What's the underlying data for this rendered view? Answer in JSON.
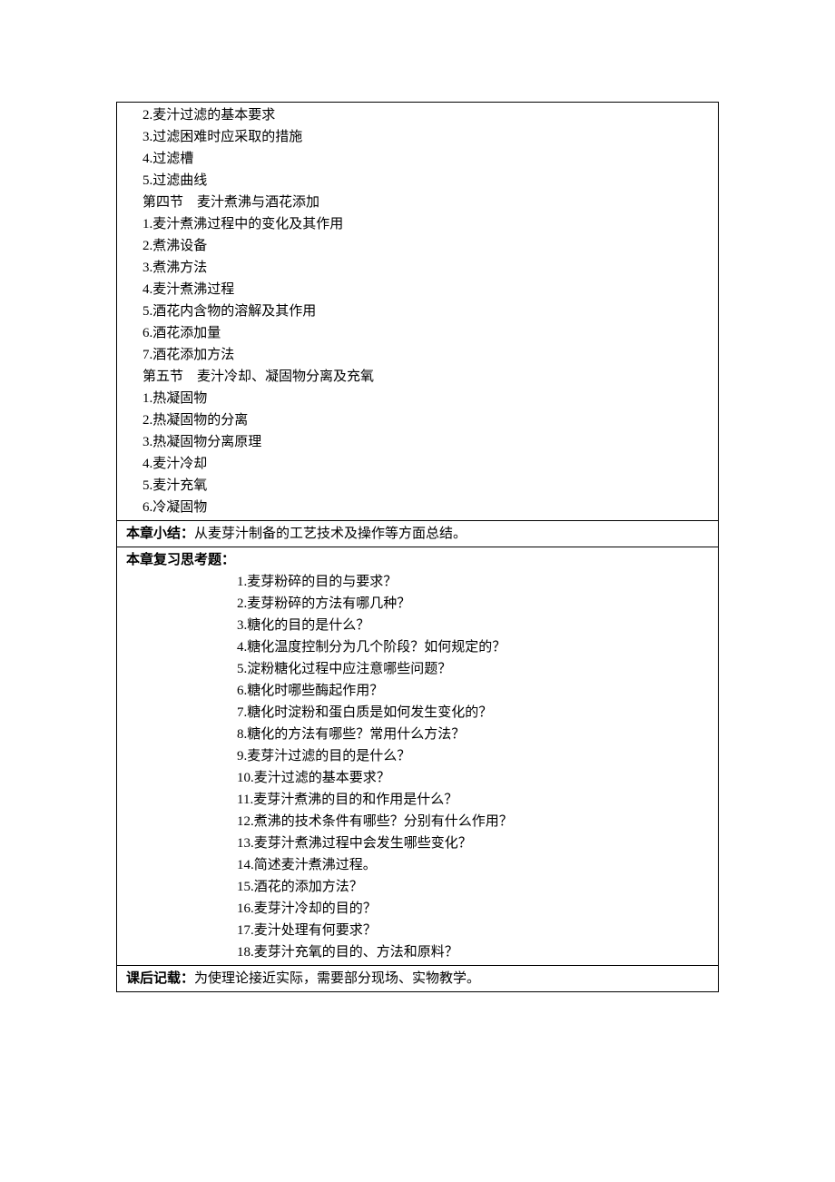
{
  "content": {
    "lines": [
      "2.麦汁过滤的基本要求",
      "3.过滤困难时应采取的措施",
      "4.过滤槽",
      "5.过滤曲线",
      "第四节　麦汁煮沸与酒花添加",
      "1.麦汁煮沸过程中的变化及其作用",
      "2.煮沸设备",
      "3.煮沸方法",
      "4.麦汁煮沸过程",
      "5.酒花内含物的溶解及其作用",
      "6.酒花添加量",
      "7.酒花添加方法",
      "第五节　麦汁冷却、凝固物分离及充氧",
      "1.热凝固物",
      "2.热凝固物的分离",
      "3.热凝固物分离原理",
      "4.麦汁冷却",
      "5.麦汁充氧",
      "6.冷凝固物"
    ]
  },
  "summary": {
    "label": "本章小结：",
    "text": "从麦芽汁制备的工艺技术及操作等方面总结。"
  },
  "review": {
    "label": "本章复习思考题：",
    "items": [
      "1.麦芽粉碎的目的与要求？",
      "2.麦芽粉碎的方法有哪几种？",
      "3.糖化的目的是什么？",
      "4.糖化温度控制分为几个阶段？如何规定的？",
      "5.淀粉糖化过程中应注意哪些问题？",
      "6.糖化时哪些酶起作用？",
      "7.糖化时淀粉和蛋白质是如何发生变化的？",
      "8.糖化的方法有哪些？常用什么方法？",
      "9.麦芽汁过滤的目的是什么？",
      "10.麦汁过滤的基本要求？",
      "11.麦芽汁煮沸的目的和作用是什么？",
      "12.煮沸的技术条件有哪些？分别有什么作用？",
      "13.麦芽汁煮沸过程中会发生哪些变化？",
      "14.简述麦汁煮沸过程。",
      "15.酒花的添加方法？",
      "16.麦芽汁冷却的目的？",
      "17.麦汁处理有何要求？",
      "18.麦芽汁充氧的目的、方法和原料？"
    ]
  },
  "postscript": {
    "label": "课后记载：",
    "text": "为使理论接近实际，需要部分现场、实物教学。"
  }
}
